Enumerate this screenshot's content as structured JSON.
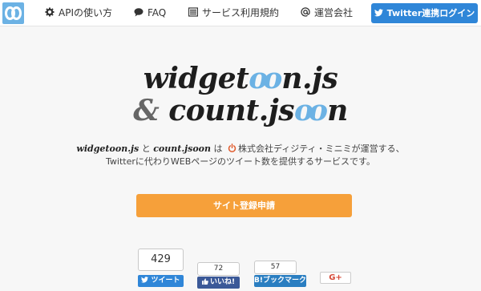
{
  "nav": {
    "items": [
      {
        "label": "APIの使い方",
        "icon": "gear-icon"
      },
      {
        "label": "FAQ",
        "icon": "speech-bubble-icon"
      },
      {
        "label": "サービス利用規約",
        "icon": "list-icon"
      },
      {
        "label": "運営会社",
        "icon": "at-icon"
      }
    ],
    "login_label": "Twitter連携ログイン"
  },
  "hero": {
    "line1_pre": "widget",
    "line1_oo": "oo",
    "line1_post": "n.js",
    "line2_amp": "&",
    "line2_pre": " count.js",
    "line2_oo": "oo",
    "line2_post": "n"
  },
  "description": {
    "name1": "widgetoon.js",
    "and": " と ",
    "name2": "count.jsoon",
    "wa": " は ",
    "line1_rest": "株式会社ディジティ・ミニミが運営する、",
    "line2": "Twitterに代わりWEBページのツイート数を提供するサービスです。"
  },
  "signup_label": "サイト登録申請",
  "share": {
    "tweet_count": "429",
    "tweet_label": "ツイート",
    "like_count": "72",
    "like_label": "いいね!",
    "hatena_count": "57",
    "hatena_label": "B!ブックマーク",
    "gplus_label": "G+"
  },
  "colors": {
    "accent_blue": "#6cb2e4",
    "twitter_blue": "#2f86d8",
    "orange": "#f6a03a"
  }
}
